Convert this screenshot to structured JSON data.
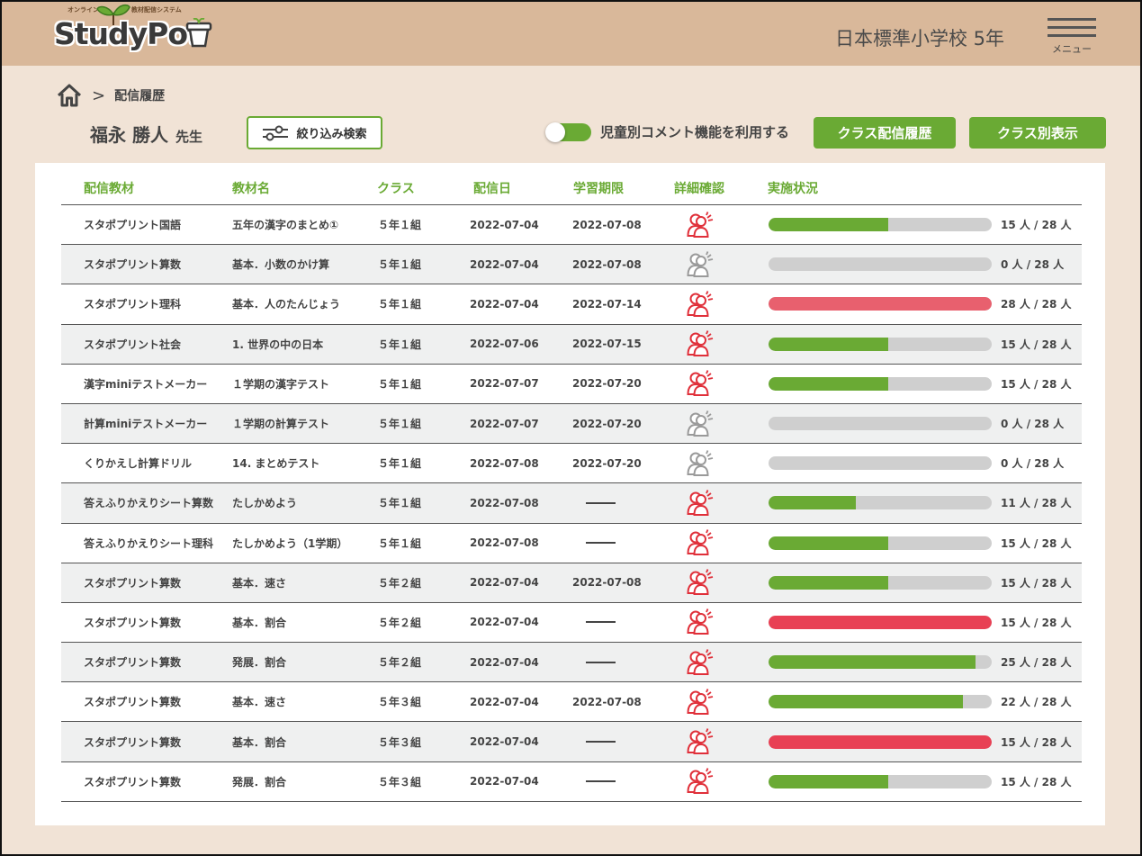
{
  "header": {
    "logo_small_left": "オンライン",
    "logo_small_right": "教材配信システム",
    "logo_text": "StudyPot",
    "school": "日本標準小学校  5年",
    "menu_label": "メニュー"
  },
  "breadcrumb": {
    "separator": ">",
    "current": "配信履歴"
  },
  "teacher": {
    "name": "福永 勝人",
    "suffix": "先生"
  },
  "toolbar": {
    "filter_label": "絞り込み検索",
    "toggle_label": "児童別コメント機能を利用する",
    "toggle_on": true,
    "history_button": "クラス配信履歴",
    "class_button": "クラス別表示"
  },
  "colors": {
    "green": "#6aaa34",
    "red_bright": "#e84054",
    "red_soft": "#e8606e",
    "grey": "#cfcfcf",
    "icon_active": "#e0303a",
    "icon_inactive": "#9a9a9a"
  },
  "table": {
    "headers": {
      "material": "配信教材",
      "name": "教材名",
      "class": "クラス",
      "date": "配信日",
      "limit": "学習期限",
      "detail": "詳細確認",
      "status": "実施状況"
    },
    "rows": [
      {
        "material": "スタポプリント国語",
        "name": "五年の漢字のまとめ①",
        "class": "５年１組",
        "date": "2022-07-04",
        "limit": "2022-07-08",
        "active": true,
        "done": 15,
        "total": 28,
        "count": "15 人 / 28 人",
        "color": "green"
      },
      {
        "material": "スタポプリント算数",
        "name": "基本．小数のかけ算",
        "class": "５年１組",
        "date": "2022-07-04",
        "limit": "2022-07-08",
        "active": false,
        "done": 0,
        "total": 28,
        "count": "0 人 / 28 人",
        "color": "green"
      },
      {
        "material": "スタポプリント理科",
        "name": "基本．人のたんじょう",
        "class": "５年１組",
        "date": "2022-07-04",
        "limit": "2022-07-14",
        "active": true,
        "done": 28,
        "total": 28,
        "count": "28 人 / 28 人",
        "color": "red_soft"
      },
      {
        "material": "スタポプリント社会",
        "name": "1. 世界の中の日本",
        "class": "５年１組",
        "date": "2022-07-06",
        "limit": "2022-07-15",
        "active": true,
        "done": 15,
        "total": 28,
        "count": "15 人 / 28 人",
        "color": "green"
      },
      {
        "material": "漢字miniテストメーカー",
        "name": "１学期の漢字テスト",
        "class": "５年１組",
        "date": "2022-07-07",
        "limit": "2022-07-20",
        "active": true,
        "done": 15,
        "total": 28,
        "count": "15 人 / 28 人",
        "color": "green"
      },
      {
        "material": "計算miniテストメーカー",
        "name": "１学期の計算テスト",
        "class": "５年１組",
        "date": "2022-07-07",
        "limit": "2022-07-20",
        "active": false,
        "done": 0,
        "total": 28,
        "count": "0 人 / 28 人",
        "color": "green"
      },
      {
        "material": "くりかえし計算ドリル",
        "name": "14. まとめテスト",
        "class": "５年１組",
        "date": "2022-07-08",
        "limit": "2022-07-20",
        "active": false,
        "done": 0,
        "total": 28,
        "count": "0 人 / 28 人",
        "color": "green"
      },
      {
        "material": "答えふりかえりシート算数",
        "name": "たしかめよう",
        "class": "５年１組",
        "date": "2022-07-08",
        "limit": "",
        "active": true,
        "done": 11,
        "total": 28,
        "count": "11 人 / 28 人",
        "color": "green"
      },
      {
        "material": "答えふりかえりシート理科",
        "name": "たしかめよう（1学期）",
        "class": "５年１組",
        "date": "2022-07-08",
        "limit": "",
        "active": true,
        "done": 15,
        "total": 28,
        "count": "15 人 / 28 人",
        "color": "green"
      },
      {
        "material": "スタポプリント算数",
        "name": "基本．速さ",
        "class": "５年２組",
        "date": "2022-07-04",
        "limit": "2022-07-08",
        "active": true,
        "done": 15,
        "total": 28,
        "count": "15 人 / 28 人",
        "color": "green"
      },
      {
        "material": "スタポプリント算数",
        "name": "基本．割合",
        "class": "５年２組",
        "date": "2022-07-04",
        "limit": "",
        "active": true,
        "done": 28,
        "total": 28,
        "count": "15 人 / 28 人",
        "color": "red_bright"
      },
      {
        "material": "スタポプリント算数",
        "name": "発展．割合",
        "class": "５年２組",
        "date": "2022-07-04",
        "limit": "",
        "active": true,
        "done": 26,
        "total": 28,
        "count": "25 人 / 28 人",
        "color": "green"
      },
      {
        "material": "スタポプリント算数",
        "name": "基本．速さ",
        "class": "５年３組",
        "date": "2022-07-04",
        "limit": "2022-07-08",
        "active": true,
        "done": 24.4,
        "total": 28,
        "count": "22 人 / 28 人",
        "color": "green"
      },
      {
        "material": "スタポプリント算数",
        "name": "基本．割合",
        "class": "５年３組",
        "date": "2022-07-04",
        "limit": "",
        "active": true,
        "done": 28,
        "total": 28,
        "count": "15 人 / 28 人",
        "color": "red_bright"
      },
      {
        "material": "スタポプリント算数",
        "name": "発展．割合",
        "class": "５年３組",
        "date": "2022-07-04",
        "limit": "",
        "active": true,
        "done": 15,
        "total": 28,
        "count": "15 人 / 28 人",
        "color": "green"
      }
    ]
  }
}
